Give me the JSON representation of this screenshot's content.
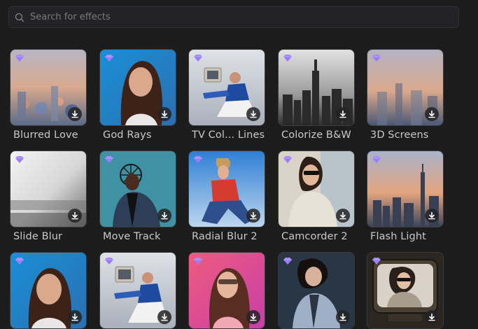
{
  "search": {
    "placeholder": "Search for effects"
  },
  "icons": {
    "search": "search-icon",
    "premium": "gem-icon",
    "download": "download-icon"
  },
  "colors": {
    "premium": "#9b7bff",
    "background": "#1c1c1d"
  },
  "effects": [
    {
      "label": "Blurred Love",
      "art": "city-sunset-blur"
    },
    {
      "label": "God Rays",
      "art": "woman-blue"
    },
    {
      "label": "TV Col... Lines",
      "art": "tv-man-white"
    },
    {
      "label": "Colorize B&W",
      "art": "city-bw"
    },
    {
      "label": "3D Screens",
      "art": "city-sunset-blur2"
    },
    {
      "label": "Slide Blur",
      "art": "white-blur"
    },
    {
      "label": "Move Track",
      "art": "man-teal"
    },
    {
      "label": "Radial Blur 2",
      "art": "man-red-blue"
    },
    {
      "label": "Camcorder 2",
      "art": "woman-beige"
    },
    {
      "label": "Flash Light",
      "art": "city-sunset"
    },
    {
      "label": "",
      "art": "woman-blue2"
    },
    {
      "label": "",
      "art": "tv-man-white2"
    },
    {
      "label": "",
      "art": "woman-pink"
    },
    {
      "label": "",
      "art": "woman-dark"
    },
    {
      "label": "",
      "art": "retro-tv"
    }
  ]
}
